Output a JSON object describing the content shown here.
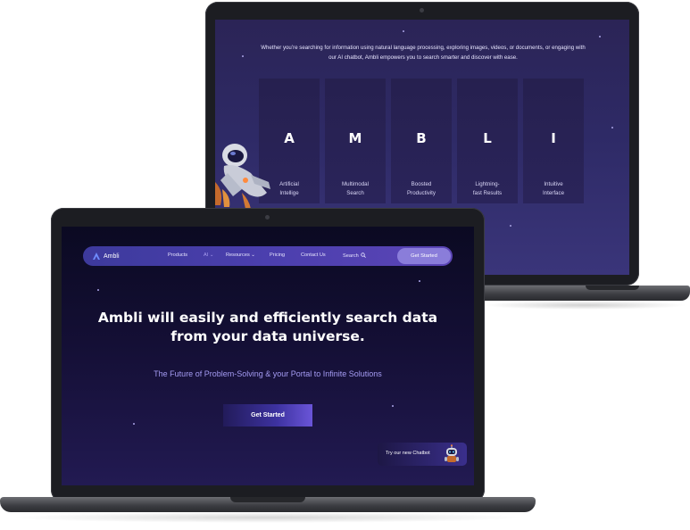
{
  "back_page": {
    "intro": "Whether you’re searching for information using natural language processing, exploring images, videos, or documents, or engaging with our AI chatbot, Ambli empowers you to search smarter and discover with ease.",
    "columns": [
      {
        "letter": "A",
        "caption_line1": "Artificial",
        "caption_line2": "Intellige"
      },
      {
        "letter": "M",
        "caption_line1": "Multimodal",
        "caption_line2": "Search"
      },
      {
        "letter": "B",
        "caption_line1": "Boosted",
        "caption_line2": "Productivity"
      },
      {
        "letter": "L",
        "caption_line1": "Lightning-",
        "caption_line2": "fast Results"
      },
      {
        "letter": "I",
        "caption_line1": "Intuitive",
        "caption_line2": "Interface"
      }
    ],
    "illustration_icon": "astronaut-illustration"
  },
  "front_page": {
    "nav": {
      "logo_text": "Ambli",
      "logo_icon": "ambli-logo-icon",
      "items": [
        {
          "label": "Products"
        },
        {
          "label": "AI ⌄"
        },
        {
          "label": "Resources ⌄"
        },
        {
          "label": "Pricing"
        },
        {
          "label": "Contact Us"
        },
        {
          "label": "Search"
        }
      ],
      "search_icon": "search-icon",
      "cta_label": "Get Started"
    },
    "hero": {
      "title_line1": "Ambli will easily and efficiently search data",
      "title_line2": "from your data universe.",
      "subtitle": "The Future of Problem-Solving & your Portal to Infinite Solutions",
      "cta_label": "Get Started"
    },
    "chatbot": {
      "label": "Try our new Chatbot",
      "icon": "robot-icon"
    }
  },
  "colors": {
    "back_screen_bg": "#2e2a66",
    "front_screen_bg": "#140f35",
    "nav_bg": "#4b3fae",
    "nav_cta_bg": "#8a7dda",
    "subtitle_text": "#a49bf2",
    "active_nav_text": "#a79cf0"
  }
}
